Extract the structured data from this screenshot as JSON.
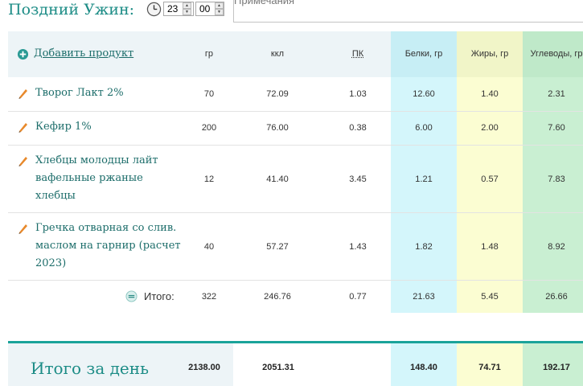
{
  "header": {
    "meal_title": "Поздний Ужин:",
    "hour": "23",
    "minute": "00",
    "notes_placeholder": "Примечания"
  },
  "table": {
    "add_product_label": "Добавить продукт",
    "columns": [
      "гр",
      "ккл",
      "ПК",
      "Белки, гр",
      "Жиры, гр",
      "Углеводы, гр"
    ],
    "rows": [
      {
        "name": "Творог Лакт 2%",
        "gr": "70",
        "kcal": "72.09",
        "pk": "1.03",
        "protein": "12.60",
        "fat": "1.40",
        "carbs": "2.31"
      },
      {
        "name": "Кефир 1%",
        "gr": "200",
        "kcal": "76.00",
        "pk": "0.38",
        "protein": "6.00",
        "fat": "2.00",
        "carbs": "7.60"
      },
      {
        "name_lines": [
          "Хлебцы молодцы лайт",
          "вафельные ржаные",
          "хлебцы"
        ],
        "gr": "12",
        "kcal": "41.40",
        "pk": "3.45",
        "protein": "1.21",
        "fat": "0.57",
        "carbs": "7.83"
      },
      {
        "name_lines": [
          "Гречка отварная со слив.",
          "маслом на гарнир (расчет",
          "2023)"
        ],
        "gr": "40",
        "kcal": "57.27",
        "pk": "1.43",
        "protein": "1.82",
        "fat": "1.48",
        "carbs": "8.92"
      }
    ],
    "total": {
      "label": "Итого:",
      "gr": "322",
      "kcal": "246.76",
      "pk": "0.77",
      "protein": "21.63",
      "fat": "5.45",
      "carbs": "26.66"
    }
  },
  "day_total": {
    "label": "Итого за день",
    "gr": "2138.00",
    "kcal": "2051.31",
    "protein": "148.40",
    "fat": "74.71",
    "carbs": "192.17"
  },
  "colors": {
    "accent": "#1c8c86",
    "protein_bg": "#d4f6fb",
    "fat_bg": "#fbfdd2",
    "carbs_bg": "#c9efd2"
  },
  "icons": {
    "clock": "clock-icon",
    "add": "plus-circle-icon",
    "edit": "pencil-icon",
    "total": "minus-circle-icon"
  }
}
